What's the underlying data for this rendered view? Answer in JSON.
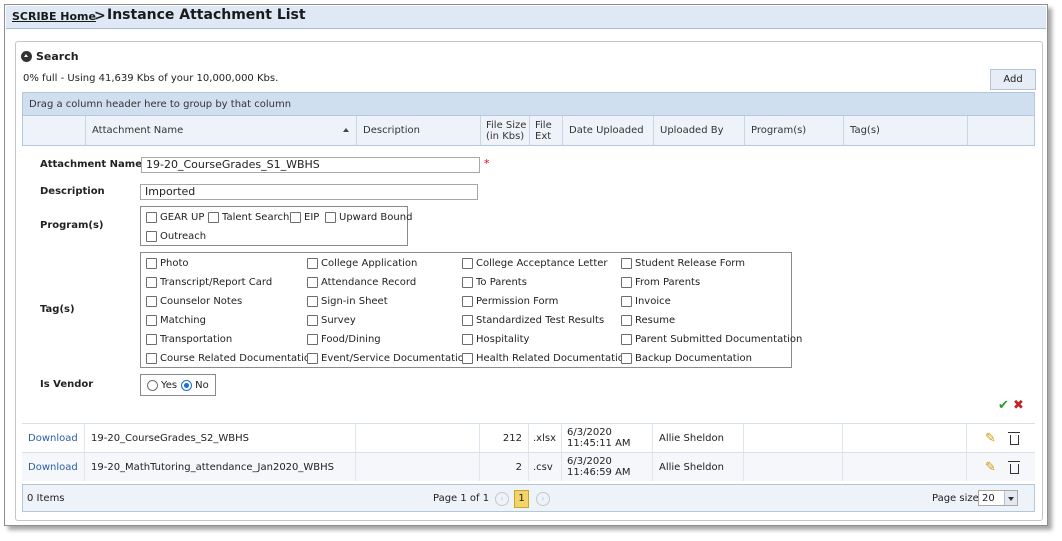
{
  "breadcrumb": {
    "home": "SCRIBE Home",
    "separator": ">",
    "title": "Instance Attachment List"
  },
  "search": {
    "label": "Search"
  },
  "usage": "0% full - Using 41,639 Kbs of your 10,000,000 Kbs.",
  "add_label": "Add",
  "group_hint": "Drag a column header here to group by that column",
  "columns": {
    "name": "Attachment Name",
    "description": "Description",
    "file_size_1": "File Size",
    "file_size_2": "(in Kbs)",
    "file_ext_1": "File",
    "file_ext_2": "Ext",
    "date": "Date Uploaded",
    "by": "Uploaded By",
    "programs": "Program(s)",
    "tags": "Tag(s)"
  },
  "form": {
    "name_label": "Attachment Name",
    "name_value": "19-20_CourseGrades_S1_WBHS",
    "required_mark": "*",
    "desc_label": "Description",
    "desc_value": "Imported",
    "programs_label": "Program(s)",
    "programs": [
      "GEAR UP",
      "Talent Search",
      "EIP",
      "Upward Bound",
      "Outreach"
    ],
    "tags_label": "Tag(s)",
    "tags": [
      "Photo",
      "College Application",
      "College Acceptance Letter",
      "Student Release Form",
      "Transcript/Report Card",
      "Attendance Record",
      "To Parents",
      "From Parents",
      "Counselor Notes",
      "Sign-in Sheet",
      "Permission Form",
      "Invoice",
      "Matching",
      "Survey",
      "Standardized Test Results",
      "Resume",
      "Transportation",
      "Food/Dining",
      "Hospitality",
      "Parent Submitted Documentation",
      "Course Related Documentation",
      "Event/Service Documentation",
      "Health Related Documentation",
      "Backup Documentation"
    ],
    "vendor_label": "Is Vendor",
    "vendor_yes": "Yes",
    "vendor_no": "No",
    "vendor_selected": "No",
    "save_glyph": "✔",
    "cancel_glyph": "✖"
  },
  "rows": [
    {
      "action": "Download",
      "name": "19-20_CourseGrades_S2_WBHS",
      "description": "",
      "size": "212",
      "ext": ".xlsx",
      "date_1": "6/3/2020",
      "date_2": "11:45:11 AM",
      "by": "Allie Sheldon",
      "programs": "",
      "tags": ""
    },
    {
      "action": "Download",
      "name": "19-20_MathTutoring_attendance_Jan2020_WBHS",
      "description": "",
      "size": "2",
      "ext": ".csv",
      "date_1": "6/3/2020",
      "date_2": "11:46:59 AM",
      "by": "Allie Sheldon",
      "programs": "",
      "tags": ""
    }
  ],
  "footer": {
    "items": "0 Items",
    "page_info": "Page 1 of 1",
    "current_page": "1",
    "page_size_label": "Page size:",
    "page_size": "20"
  },
  "icons": {
    "search_toggle": "collapse-circle-icon",
    "edit": "pencil-icon",
    "delete": "trash-icon",
    "save": "checkmark-icon",
    "cancel": "close-icon"
  },
  "colors": {
    "accent": "#1a6fd8",
    "header_bg": "#dfe9f5",
    "current_page": "#f3d46a",
    "save": "#2e9a2e",
    "cancel": "#c0242a"
  }
}
